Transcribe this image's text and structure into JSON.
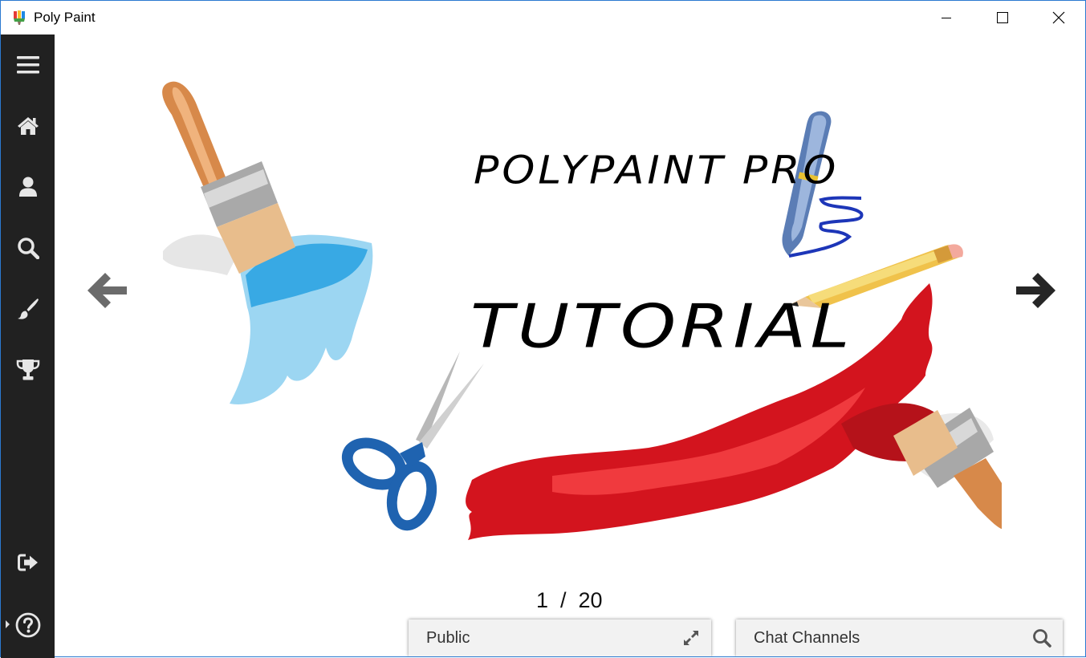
{
  "window": {
    "title": "Poly Paint",
    "controls": [
      "minimize-icon",
      "maximize-icon",
      "close-icon"
    ]
  },
  "sidebar": {
    "items": [
      {
        "name": "menu",
        "icon": "hamburger-menu-icon"
      },
      {
        "name": "home",
        "icon": "home-icon"
      },
      {
        "name": "profile",
        "icon": "user-icon"
      },
      {
        "name": "search",
        "icon": "search-icon"
      },
      {
        "name": "draw",
        "icon": "paintbrush-icon"
      },
      {
        "name": "achievements",
        "icon": "trophy-icon"
      },
      {
        "name": "logout",
        "icon": "logout-icon"
      },
      {
        "name": "help",
        "icon": "help-icon"
      }
    ]
  },
  "tutorial": {
    "heading": "POLYPAINT PRO",
    "subheading": "TUTORIAL",
    "page_counter": "1  /  20",
    "prev_icon": "arrow-left-icon",
    "next_icon": "arrow-right-icon"
  },
  "chat": {
    "public_label": "Public",
    "public_icon": "expand-icon",
    "channels_label": "Chat Channels",
    "channels_icon": "search-icon"
  },
  "colors": {
    "sidebar_bg": "#212121",
    "sidebar_icon": "#e6e6e6",
    "prev_arrow": "#6b6b6b",
    "next_arrow": "#262626",
    "panel_bg": "#f2f2f2",
    "blue_paint": "#4fb4e6",
    "red_paint": "#d3141e"
  }
}
